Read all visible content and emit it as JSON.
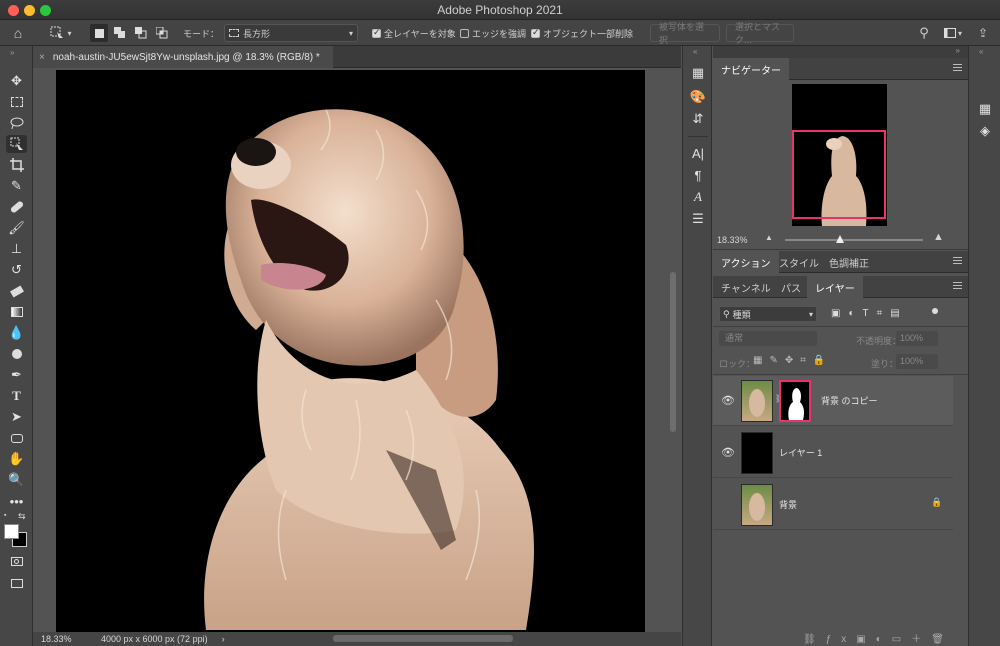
{
  "window": {
    "title": "Adobe Photoshop 2021"
  },
  "options_bar": {
    "mode_label": "モード：",
    "mode_value": "長方形",
    "sample_all_layers": "全レイヤーを対象",
    "enhance_edge": "エッジを強調",
    "object_subtract": "オブジェクト一部削除",
    "select_subject": "被写体を選択",
    "select_and_mask": "選択とマスク..."
  },
  "document": {
    "tab_title": "noah-austin-JU5ewSjt8Yw-unsplash.jpg @ 18.3% (RGB/8) *",
    "zoom": "18.33%",
    "dimensions": "4000 px x 6000 px (72 ppi)"
  },
  "navigator": {
    "tab": "ナビゲーター",
    "zoom": "18.33%",
    "slider_fraction": 0.4
  },
  "actions_group": {
    "tabs": [
      "アクション",
      "スタイル",
      "色調補正"
    ]
  },
  "layers_group": {
    "tabs": [
      "チャンネル",
      "パス",
      "レイヤー"
    ],
    "filter_kind": "種類",
    "blend_mode": "通常",
    "opacity_label": "不透明度：",
    "opacity_value": "100%",
    "lock_label": "ロック：",
    "fill_label": "塗り：",
    "fill_value": "100%",
    "layers": [
      {
        "name": "背景 のコピー",
        "visible": true,
        "has_mask": true
      },
      {
        "name": "レイヤー 1",
        "visible": true,
        "has_mask": false
      },
      {
        "name": "背景",
        "visible": false,
        "has_mask": false,
        "locked": true
      }
    ]
  },
  "colors": {
    "accent_pink": "#e8336d",
    "panel_bg": "#535353"
  }
}
